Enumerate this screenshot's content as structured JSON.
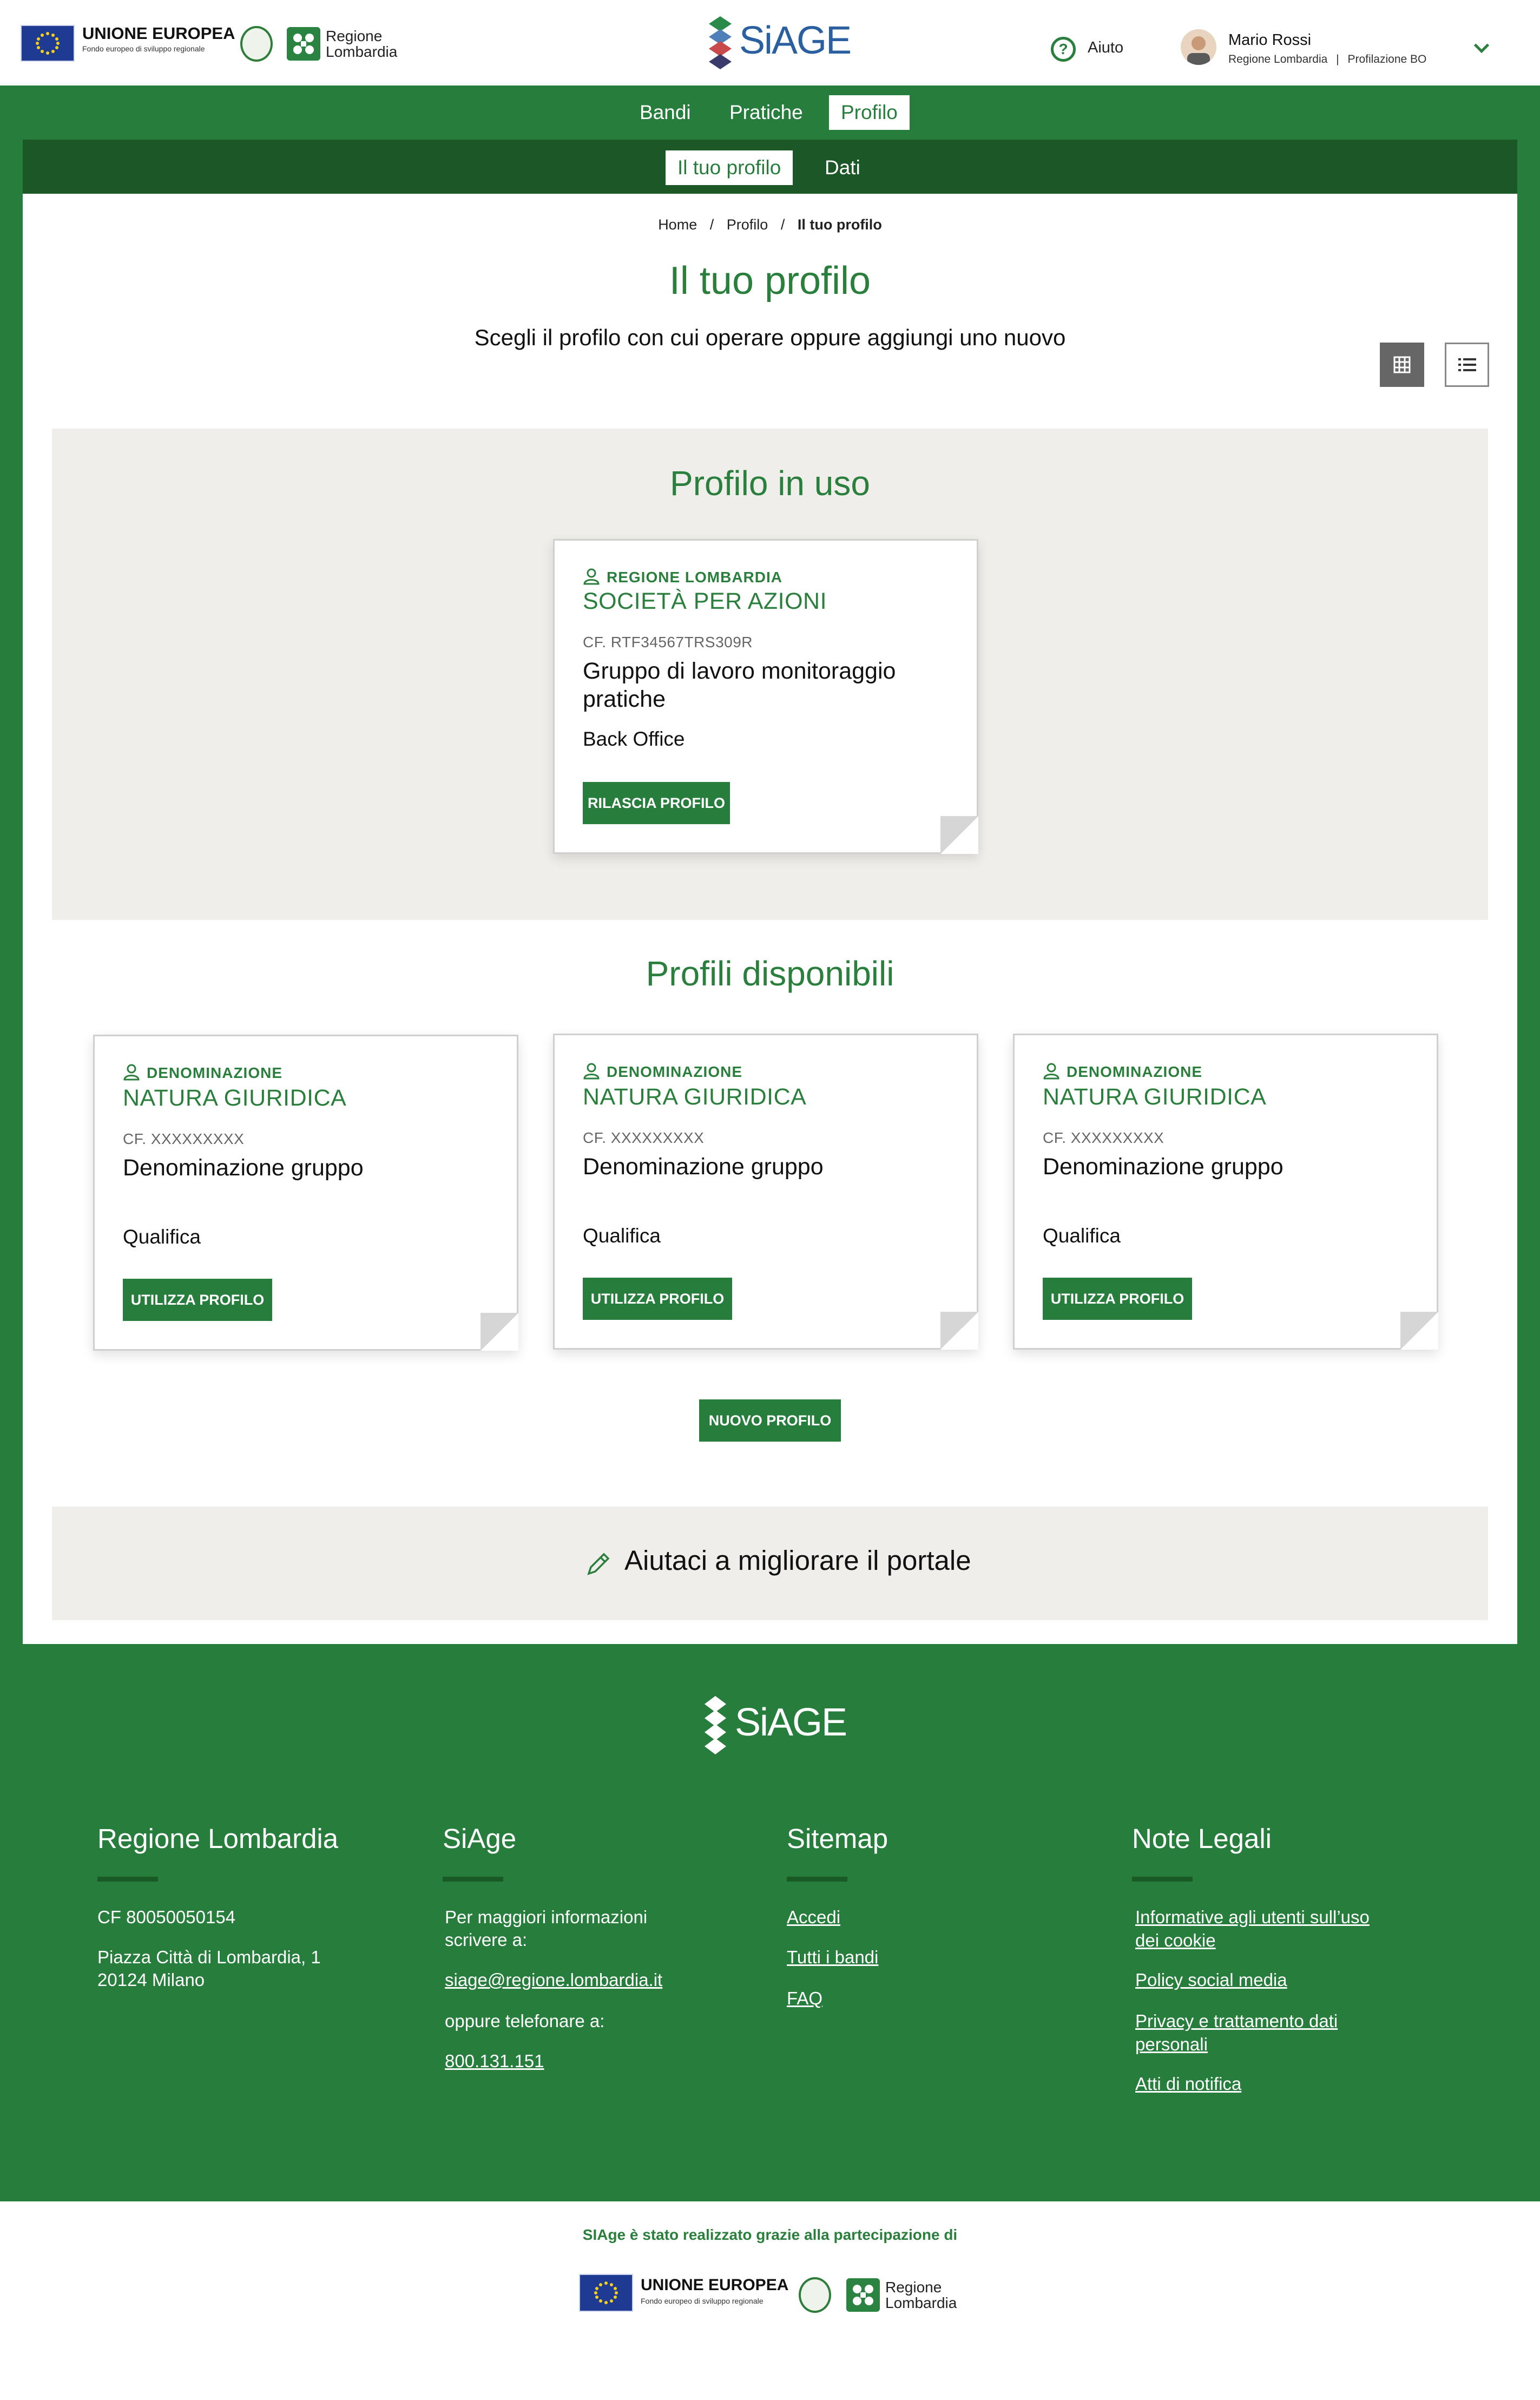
{
  "header": {
    "eu_label": "UNIONE EUROPEA",
    "eu_sublabel": "Fondo europeo di sviluppo regionale",
    "rl_label_1": "Regione",
    "rl_label_2": "Lombardia",
    "app_name": "SiAGE",
    "help_label": "Aiuto",
    "user_name": "Mario Rossi",
    "user_org": "Regione Lombardia",
    "user_role": "Profilazione BO",
    "user_sep": "|"
  },
  "nav": {
    "items": [
      {
        "label": "Bandi",
        "active": false
      },
      {
        "label": "Pratiche",
        "active": false
      },
      {
        "label": "Profilo",
        "active": true
      }
    ]
  },
  "subnav": {
    "items": [
      {
        "label": "Il tuo profilo",
        "active": true
      },
      {
        "label": "Dati",
        "active": false
      }
    ]
  },
  "breadcrumb": {
    "items": [
      "Home",
      "Profilo",
      "Il tuo profilo"
    ],
    "separator": "/"
  },
  "page": {
    "title": "Il tuo profilo",
    "subtitle": "Scegli il profilo con cui operare oppure aggiungi uno nuovo"
  },
  "current_section": {
    "title": "Profilo in uso"
  },
  "current_profile": {
    "org": "REGIONE LOMBARDIA",
    "legal_form": "SOCIETÀ PER AZIONI",
    "cf": "CF. RTF34567TRS309R",
    "group": "Gruppo di lavoro monitoraggio pratiche",
    "role": "Back Office",
    "button": "RILASCIA PROFILO"
  },
  "available_section": {
    "title": "Profili disponibili"
  },
  "available_profiles": [
    {
      "org": "DENOMINAZIONE",
      "legal_form": "NATURA GIURIDICA",
      "cf": "CF. XXXXXXXXX",
      "group": "Denominazione gruppo",
      "role": "Qualifica",
      "button": "UTILIZZA PROFILO"
    },
    {
      "org": "DENOMINAZIONE",
      "legal_form": "NATURA GIURIDICA",
      "cf": "CF. XXXXXXXXX",
      "group": "Denominazione gruppo",
      "role": "Qualifica",
      "button": "UTILIZZA PROFILO"
    },
    {
      "org": "DENOMINAZIONE",
      "legal_form": "NATURA GIURIDICA",
      "cf": "CF. XXXXXXXXX",
      "group": "Denominazione gruppo",
      "role": "Qualifica",
      "button": "UTILIZZA PROFILO"
    }
  ],
  "new_profile_button": "NUOVO PROFILO",
  "feedback": {
    "label": "Aiutaci a migliorare il portale"
  },
  "footer": {
    "logo": "SiAGE",
    "col1": {
      "title": "Regione Lombardia",
      "cf": "CF 80050050154",
      "address_1": "Piazza Città di Lombardia, 1",
      "address_2": "20124 Milano"
    },
    "col2": {
      "title": "SiAge",
      "info_1": "Per maggiori informazioni",
      "info_2": "scrivere a:",
      "email": "siage@regione.lombardia.it",
      "phone_label": "oppure telefonare a:",
      "phone": "800.131.151"
    },
    "col3": {
      "title": "Sitemap",
      "links": [
        "Accedi",
        "Tutti i bandi",
        "FAQ"
      ]
    },
    "col4": {
      "title": "Note Legali",
      "link1_line1": "Informative agli utenti sull’uso",
      "link1_line2": "dei cookie",
      "link2": "Policy social media",
      "link3_line1": "Privacy e trattamento dati",
      "link3_line2": "personali",
      "link4": "Atti di notifica"
    }
  },
  "bottom": {
    "note": "SIAge è stato realizzato grazie alla partecipazione di"
  },
  "colors": {
    "brand_green": "#277d3c",
    "dark_green": "#1b5727",
    "panel_grey": "#efeeea"
  }
}
